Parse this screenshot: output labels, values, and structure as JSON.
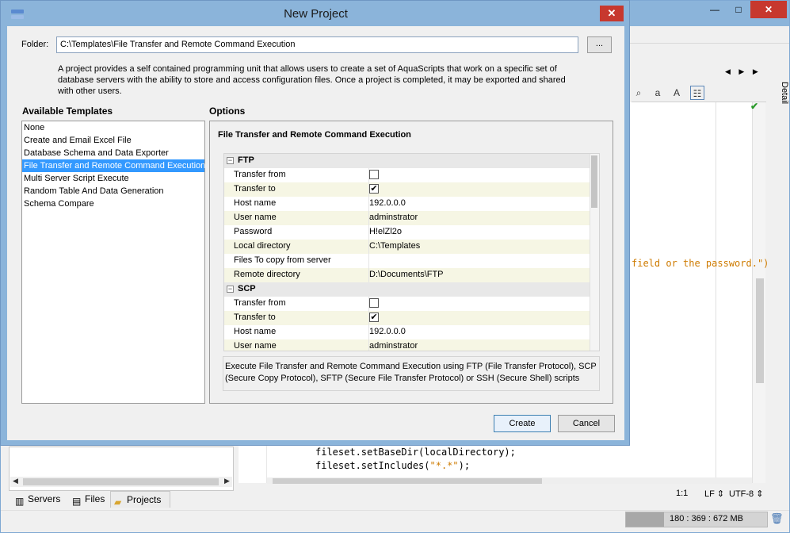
{
  "dialog": {
    "title": "New Project",
    "folder_label": "Folder:",
    "folder_value": "C:\\Templates\\File Transfer and Remote Command Execution",
    "browse_label": "...",
    "description": "A project provides a self contained programming unit that allows users to create a set of AquaScripts that work on a specific set of database servers with the ability to store and access configuration files.  Once a project is completed, it may be exported and shared with other users.",
    "templates_heading": "Available Templates",
    "options_heading": "Options",
    "templates": [
      {
        "label": "None",
        "selected": false
      },
      {
        "label": "Create and Email Excel File",
        "selected": false
      },
      {
        "label": "Database Schema and Data Exporter",
        "selected": false
      },
      {
        "label": "File Transfer and Remote Command Execution",
        "selected": true
      },
      {
        "label": "Multi Server Script Execute",
        "selected": false
      },
      {
        "label": "Random Table And Data Generation",
        "selected": false
      },
      {
        "label": "Schema Compare",
        "selected": false
      }
    ],
    "options_title": "File Transfer and Remote Command Execution",
    "property_groups": [
      {
        "name": "FTP",
        "rows": [
          {
            "name": "Transfer from",
            "type": "checkbox",
            "checked": false
          },
          {
            "name": "Transfer to",
            "type": "checkbox",
            "checked": true
          },
          {
            "name": "Host name",
            "type": "text",
            "value": "192.0.0.0"
          },
          {
            "name": "User name",
            "type": "text",
            "value": "adminstrator"
          },
          {
            "name": "Password",
            "type": "text",
            "value": "H!elZl2o"
          },
          {
            "name": "Local directory",
            "type": "text",
            "value": "C:\\Templates"
          },
          {
            "name": "Files To copy from server",
            "type": "text",
            "value": ""
          },
          {
            "name": "Remote directory",
            "type": "text",
            "value": "D:\\Documents\\FTP"
          }
        ]
      },
      {
        "name": "SCP",
        "rows": [
          {
            "name": "Transfer from",
            "type": "checkbox",
            "checked": false
          },
          {
            "name": "Transfer to",
            "type": "checkbox",
            "checked": true
          },
          {
            "name": "Host name",
            "type": "text",
            "value": "192.0.0.0"
          },
          {
            "name": "User name",
            "type": "text",
            "value": "adminstrator"
          }
        ]
      }
    ],
    "option_description": "Execute File Transfer and Remote Command Execution using FTP (File Transfer Protocol), SCP (Secure Copy Protocol), SFTP (Secure File Transfer Protocol) or SSH (Secure Shell) scripts",
    "create_label": "Create",
    "cancel_label": "Cancel",
    "check_glyph": "✔",
    "collapse_glyph": "−"
  },
  "ide": {
    "window_controls": {
      "minimize": "—",
      "restore": "□",
      "close": "✕"
    },
    "nav_arrows": "◀ ▶ ▶",
    "detail_tab": "Detail",
    "code_lines": [
      {
        "text": "field or the password.\")",
        "kind": "string"
      },
      {
        "text": "fileset.setBaseDir(localDirectory);",
        "kind": "code"
      },
      {
        "text_prefix": "fileset.setIncludes(",
        "text_string": "\"*.*\"",
        "text_suffix": ");",
        "kind": "mixed"
      }
    ],
    "status": {
      "position": "1:1",
      "line_ending": "LF",
      "encoding": "UTF-8"
    },
    "left_tabs": [
      {
        "label": "Servers",
        "icon": "servers-icon"
      },
      {
        "label": "Files",
        "icon": "files-icon"
      },
      {
        "label": "Projects",
        "icon": "projects-icon",
        "active": true
      }
    ],
    "memory": {
      "text": "180 : 369 : 672 MB",
      "used_fraction": 0.27
    },
    "colors": {
      "titlebar": "#8bb4da",
      "close": "#c7382e",
      "selection": "#3399ff",
      "string": "#ce7b00"
    }
  }
}
